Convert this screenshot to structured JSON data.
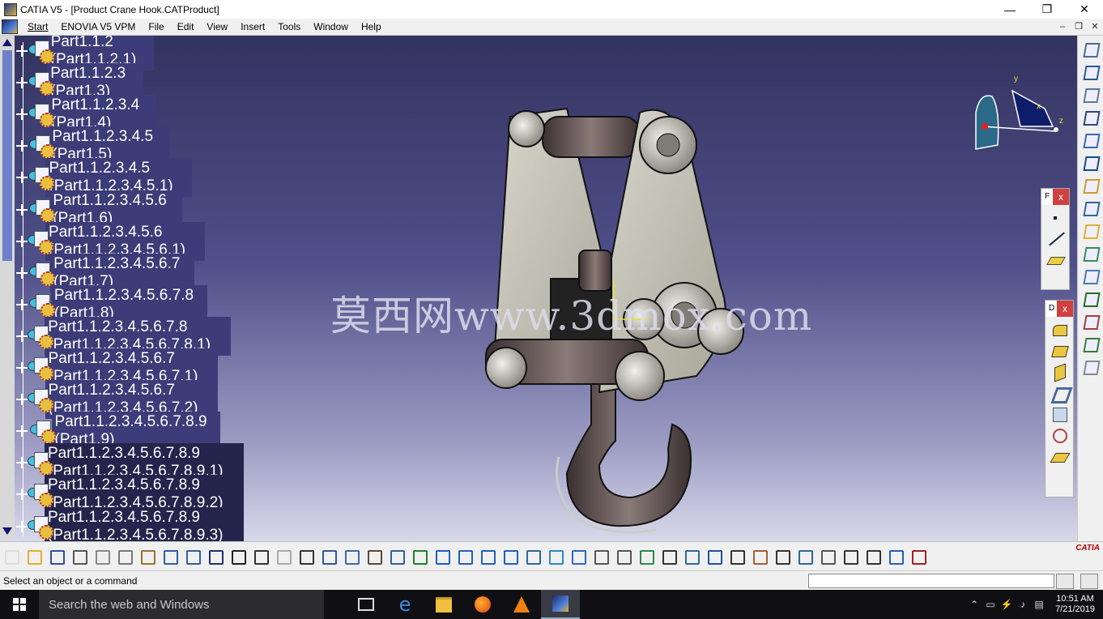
{
  "window": {
    "title": "CATIA V5 - [Product Crane Hook.CATProduct]",
    "minimize": "—",
    "maximize": "❐",
    "close": "✕"
  },
  "menu": {
    "items": [
      "Start",
      "ENOVIA V5 VPM",
      "File",
      "Edit",
      "View",
      "Insert",
      "Tools",
      "Window",
      "Help"
    ],
    "mdi": [
      "–",
      "❐",
      "✕"
    ]
  },
  "tree": {
    "items": [
      {
        "label": "Part1.1.2 (Part1.1.2.1)",
        "style": "sel"
      },
      {
        "label": "Part1.1.2.3 (Part1.3)",
        "style": "sel"
      },
      {
        "label": "Part1.1.2.3.4 (Part1.4)",
        "style": "sel"
      },
      {
        "label": "Part1.1.2.3.4.5 (Part1.5)",
        "style": "sel"
      },
      {
        "label": "Part1.1.2.3.4.5 (Part1.1.2.3.4.5.1)",
        "style": "sel"
      },
      {
        "label": "Part1.1.2.3.4.5.6 (Part1.6)",
        "style": "sel"
      },
      {
        "label": "Part1.1.2.3.4.5.6 (Part1.1.2.3.4.5.6.1)",
        "style": "sel"
      },
      {
        "label": "Part1.1.2.3.4.5.6.7 (Part1.7)",
        "style": "sel"
      },
      {
        "label": "Part1.1.2.3.4.5.6.7.8 (Part1.8)",
        "style": "sel"
      },
      {
        "label": "Part1.1.2.3.4.5.6.7.8 (Part1.1.2.3.4.5.6.7.8.1)",
        "style": "sel"
      },
      {
        "label": "Part1.1.2.3.4.5.6.7 (Part1.1.2.3.4.5.6.7.1)",
        "style": "sel"
      },
      {
        "label": "Part1.1.2.3.4.5.6.7 (Part1.1.2.3.4.5.6.7.2)",
        "style": "sel"
      },
      {
        "label": "Part1.1.2.3.4.5.6.7.8.9 (Part1.9)",
        "style": "sel"
      },
      {
        "label": "Part1.1.2.3.4.5.6.7.8.9 (Part1.1.2.3.4.5.6.7.8.9.1)",
        "style": "sel2"
      },
      {
        "label": "Part1.1.2.3.4.5.6.7.8.9 (Part1.1.2.3.4.5.6.7.8.9.2)",
        "style": "sel2"
      },
      {
        "label": "Part1.1.2.3.4.5.6.7.8.9 (Part1.1.2.3.4.5.6.7.8.9.3)",
        "style": "sel2"
      }
    ]
  },
  "watermark": "莫西网www.3dmox.com",
  "compass": {
    "x": "x",
    "y": "y",
    "z": "z"
  },
  "floatbar1": {
    "title": "F",
    "close": "x"
  },
  "floatbar2": {
    "title": "D",
    "close": "x"
  },
  "status": {
    "message": "Select an object or a command",
    "command_value": ""
  },
  "taskbar": {
    "search_placeholder": "Search the web and Windows",
    "time": "10:51 AM",
    "date": "7/21/2019"
  },
  "branding": {
    "logo": "CATIA"
  },
  "icons": {
    "right_toolbar": [
      "sketch-icon",
      "axis-icon",
      "edit-icon",
      "pad-icon",
      "pocket-icon",
      "shaft-icon",
      "groove-icon",
      "hole-icon",
      "rib-icon",
      "slot-icon",
      "loft-icon",
      "fillet-icon",
      "chamfer-icon",
      "draft-icon",
      "shell-icon"
    ],
    "bottom_toolbar": [
      "new-icon",
      "open-icon",
      "save-icon",
      "print-icon",
      "cut-icon",
      "copy-icon",
      "paste-icon",
      "undo-icon",
      "redo-icon",
      "whats-this-icon",
      "formula-icon",
      "comment-icon",
      "light-icon",
      "table-icon",
      "tree-icon",
      "catalog-icon",
      "measure-icon",
      "fly-icon",
      "fit-all-icon",
      "pan-icon",
      "rotate-icon",
      "zoom-in-icon",
      "zoom-out-icon",
      "normal-view-icon",
      "multi-view-icon",
      "iso-view-icon",
      "hide-show-icon",
      "swap-icon",
      "shading-icon",
      "camera-icon",
      "analysis-icon",
      "manipulate-icon",
      "snap-icon",
      "clash-icon",
      "photo-icon",
      "refresh-icon",
      "hand-icon",
      "axis-system-icon",
      "scale-icon",
      "update-icon",
      "constraint-icon"
    ]
  },
  "colors": {
    "viewport_top": "#333360",
    "viewport_bottom": "#d8d8ea",
    "selection": "#3c3c78"
  }
}
